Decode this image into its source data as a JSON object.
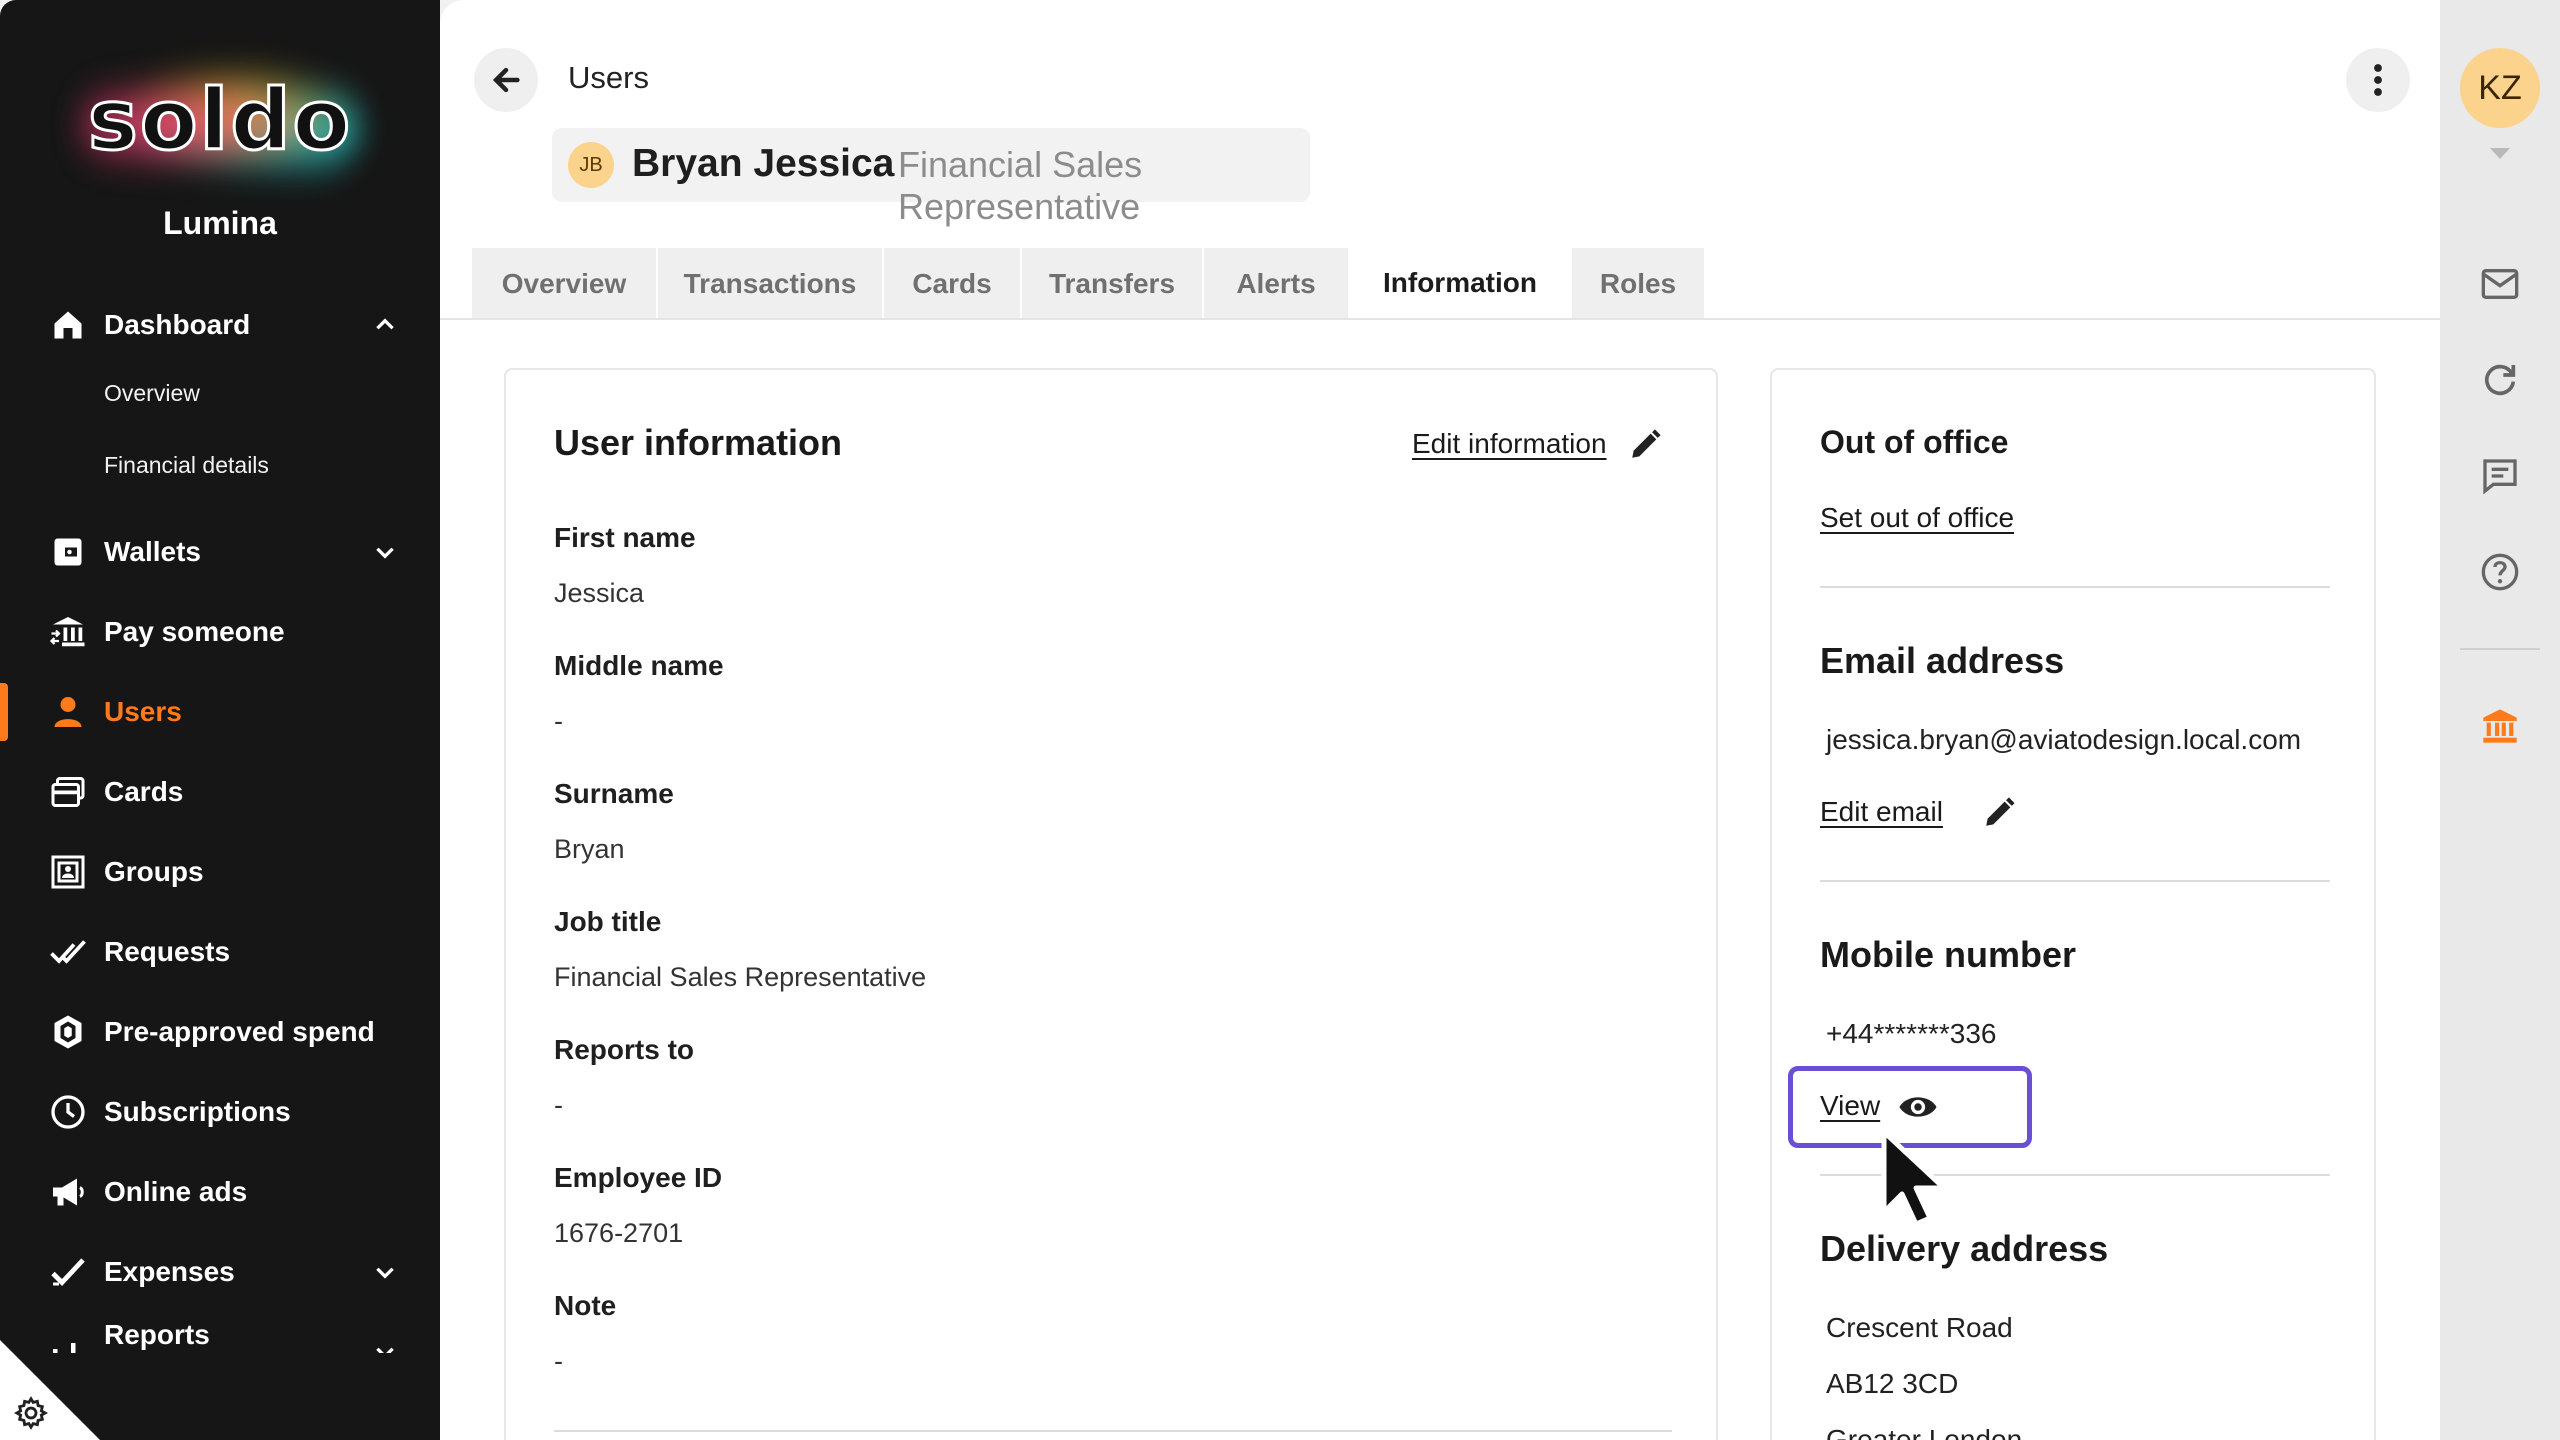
{
  "brand": {
    "logo_text": "soldo",
    "org_name": "Lumina"
  },
  "sidebar": {
    "items": [
      {
        "label": "Dashboard",
        "icon": "home-icon"
      },
      {
        "label": "Overview"
      },
      {
        "label": "Financial details"
      },
      {
        "label": "Wallets",
        "icon": "wallet-icon"
      },
      {
        "label": "Pay someone",
        "icon": "bank-transfer-icon"
      },
      {
        "label": "Users",
        "icon": "user-icon",
        "active": true
      },
      {
        "label": "Cards",
        "icon": "cards-icon"
      },
      {
        "label": "Groups",
        "icon": "groups-icon"
      },
      {
        "label": "Requests",
        "icon": "double-check-icon"
      },
      {
        "label": "Pre-approved spend",
        "icon": "shield-hexagon-icon"
      },
      {
        "label": "Subscriptions",
        "icon": "clock-icon"
      },
      {
        "label": "Online ads",
        "icon": "megaphone-icon"
      },
      {
        "label": "Expenses",
        "icon": "check-icon"
      },
      {
        "label": "Reports",
        "icon": "bar-chart-icon"
      }
    ]
  },
  "header": {
    "breadcrumb": "Users",
    "user_initials": "JB",
    "user_name": "Bryan Jessica",
    "user_role": "Financial Sales Representative"
  },
  "tabs": [
    {
      "label": "Overview"
    },
    {
      "label": "Transactions"
    },
    {
      "label": "Cards"
    },
    {
      "label": "Transfers"
    },
    {
      "label": "Alerts"
    },
    {
      "label": "Information",
      "active": true
    },
    {
      "label": "Roles"
    }
  ],
  "user_info": {
    "title": "User information",
    "edit_label": "Edit information",
    "fields": [
      {
        "label": "First name",
        "value": "Jessica"
      },
      {
        "label": "Middle name",
        "value": "-"
      },
      {
        "label": "Surname",
        "value": "Bryan"
      },
      {
        "label": "Job title",
        "value": "Financial Sales Representative"
      },
      {
        "label": "Reports to",
        "value": "-"
      },
      {
        "label": "Employee ID",
        "value": "1676-2701"
      },
      {
        "label": "Note",
        "value": "-"
      }
    ]
  },
  "right_panel": {
    "out_of_office_title": "Out of office",
    "set_out_of_office": "Set out of office",
    "email_title": "Email address",
    "email": "jessica.bryan@aviatodesign.local.com",
    "edit_email": "Edit email",
    "mobile_title": "Mobile number",
    "mobile": "+44*******336",
    "view_label": "View",
    "delivery_title": "Delivery address",
    "address_line1": "Crescent Road",
    "address_line2": "AB12 3CD",
    "address_line3": "Greater London"
  },
  "rail": {
    "initials": "KZ"
  },
  "colors": {
    "accent": "#ff7a1a",
    "highlight": "#6a4fd6",
    "sidebar_bg": "#161616"
  }
}
